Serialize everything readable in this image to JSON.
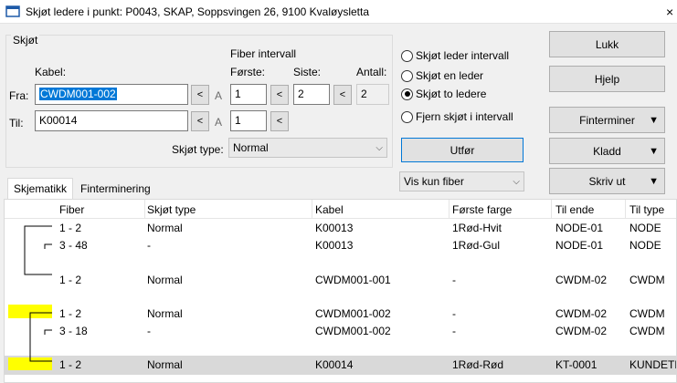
{
  "window": {
    "title": "Skjøt ledere i punkt: P0043, SKAP, Soppsvingen 26, 9100 Kvaløysletta",
    "close_glyph": "×"
  },
  "form": {
    "group_label": "Skjøt",
    "kabel_label": "Kabel:",
    "fiber_interval_label": "Fiber intervall",
    "forste_label": "Første:",
    "siste_label": "Siste:",
    "antall_label": "Antall:",
    "fra_label": "Fra:",
    "til_label": "Til:",
    "fra_kabel": "CWDM001-002",
    "til_kabel": "K00014",
    "fra_forste": "1",
    "fra_siste": "2",
    "antall": "2",
    "til_forste": "1",
    "nav_btn": "<",
    "a_label": "A",
    "skjot_type_label": "Skjøt type:",
    "skjot_type_value": "Normal"
  },
  "radios": [
    {
      "label": "Skjøt leder intervall",
      "checked": false
    },
    {
      "label": "Skjøt en leder",
      "checked": false
    },
    {
      "label": "Skjøt to ledere",
      "checked": true
    },
    {
      "label": "Fjern skjøt i intervall",
      "checked": false
    }
  ],
  "utfor_label": "Utfør",
  "vis_kun_label": "Vis kun fiber",
  "right_buttons": {
    "lukk": "Lukk",
    "hjelp": "Hjelp",
    "finterminer": "Finterminer",
    "kladd": "Kladd",
    "skriv_ut": "Skriv ut"
  },
  "tabs": [
    "Skjematikk",
    "Finterminering"
  ],
  "table": {
    "headers": [
      "Fiber",
      "Skjøt type",
      "Kabel",
      "Første farge",
      "Til ende",
      "Til type"
    ],
    "rows": [
      {
        "fiber": "1 - 2",
        "skjot": "Normal",
        "kabel": "K00013",
        "farge": "1Rød-Hvit",
        "ende": "NODE-01",
        "type": "NODE",
        "selected": false
      },
      {
        "fiber": "3 - 48",
        "skjot": "-",
        "kabel": "K00013",
        "farge": "1Rød-Gul",
        "ende": "NODE-01",
        "type": "NODE",
        "selected": false
      },
      {
        "fiber": "1 - 2",
        "skjot": "Normal",
        "kabel": "CWDM001-001",
        "farge": "-",
        "ende": "CWDM-02",
        "type": "CWDM",
        "selected": false
      },
      {
        "fiber": "1 - 2",
        "skjot": "Normal",
        "kabel": "CWDM001-002",
        "farge": "-",
        "ende": "CWDM-02",
        "type": "CWDM",
        "selected": false
      },
      {
        "fiber": "3 - 18",
        "skjot": "-",
        "kabel": "CWDM001-002",
        "farge": "-",
        "ende": "CWDM-02",
        "type": "CWDM",
        "selected": false
      },
      {
        "fiber": "1 - 2",
        "skjot": "Normal",
        "kabel": "K00014",
        "farge": "1Rød-Rød",
        "ende": "KT-0001",
        "type": "KUNDETE",
        "selected": true
      }
    ]
  },
  "colors": {
    "highlight": "#ffff00",
    "selection": "#d9d9d9",
    "input_selection": "#0078d7"
  }
}
